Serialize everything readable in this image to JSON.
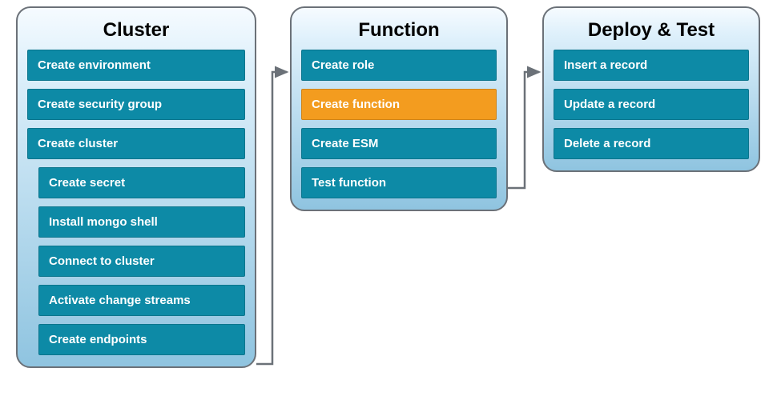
{
  "panels": {
    "cluster": {
      "title": "Cluster",
      "items": [
        "Create environment",
        "Create security group",
        "Create cluster",
        "Create secret",
        "Install mongo shell",
        "Connect to cluster",
        "Activate change streams",
        "Create endpoints"
      ]
    },
    "function": {
      "title": "Function",
      "items": [
        "Create role",
        "Create function",
        "Create ESM",
        "Test function"
      ],
      "highlight_index": 1
    },
    "deploy": {
      "title": "Deploy & Test",
      "items": [
        "Insert a record",
        "Update a record",
        "Delete a record"
      ]
    }
  },
  "colors": {
    "item_default": "#0d8aa6",
    "item_highlight": "#f39c1f",
    "panel_border": "#6b7178",
    "arrow": "#6b7178"
  }
}
